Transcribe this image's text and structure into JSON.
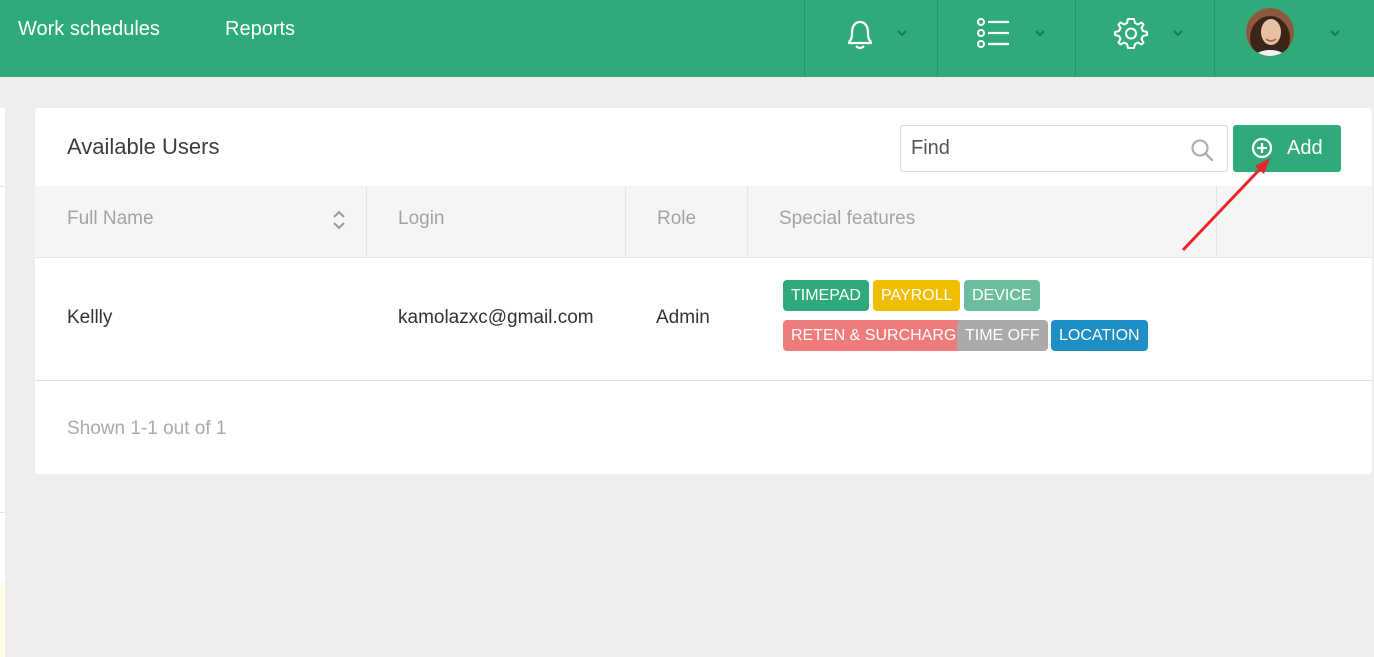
{
  "nav": {
    "links": [
      "Work schedules",
      "Reports"
    ],
    "icons": [
      "bell-icon",
      "list-icon",
      "gear-icon",
      "avatar"
    ]
  },
  "card": {
    "title": "Available Users",
    "search_placeholder": "Find",
    "add_label": "Add"
  },
  "table": {
    "columns": [
      "Full Name",
      "Login",
      "Role",
      "Special features"
    ],
    "rows": [
      {
        "name": "Kellly",
        "login": "kamolazxc@gmail.com",
        "role": "Admin",
        "features": [
          {
            "label": "TIMEPAD",
            "color": "#2eaa7b"
          },
          {
            "label": "PAYROLL",
            "color": "#f0c000"
          },
          {
            "label": "DEVICE",
            "color": "#6cbf9e"
          },
          {
            "label": "RETEN & SURCHARG",
            "color": "#f07b7b"
          },
          {
            "label": "TIME OFF",
            "color": "#aaaaaa"
          },
          {
            "label": "LOCATION",
            "color": "#1e8fc4"
          }
        ]
      }
    ]
  },
  "footer": {
    "summary": "Shown 1-1 out of 1"
  },
  "colors": {
    "brand": "#2eaa7b",
    "annotation": "#e8262a"
  }
}
